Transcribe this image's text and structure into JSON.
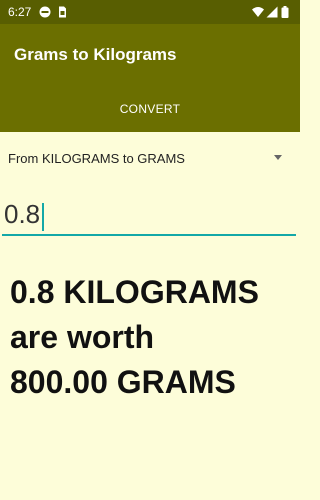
{
  "status_bar": {
    "time": "6:27",
    "icons": [
      "no-disturb-icon",
      "sim-card-icon",
      "wifi-icon",
      "signal-icon",
      "battery-icon"
    ]
  },
  "app_bar": {
    "title": "Grams to Kilograms"
  },
  "convert_button": {
    "label": "CONVERT"
  },
  "conversion_spinner": {
    "selected": "From KILOGRAMS to GRAMS"
  },
  "amount_input": {
    "value": "0.8"
  },
  "result": {
    "line1": "0.8 KILOGRAMS",
    "line2": "are worth",
    "line3": "800.00 GRAMS"
  },
  "colors": {
    "status_bar": "#585e01",
    "app_bar": "#6b6f00",
    "background": "#fdfdd9",
    "accent": "#13a8a8"
  }
}
